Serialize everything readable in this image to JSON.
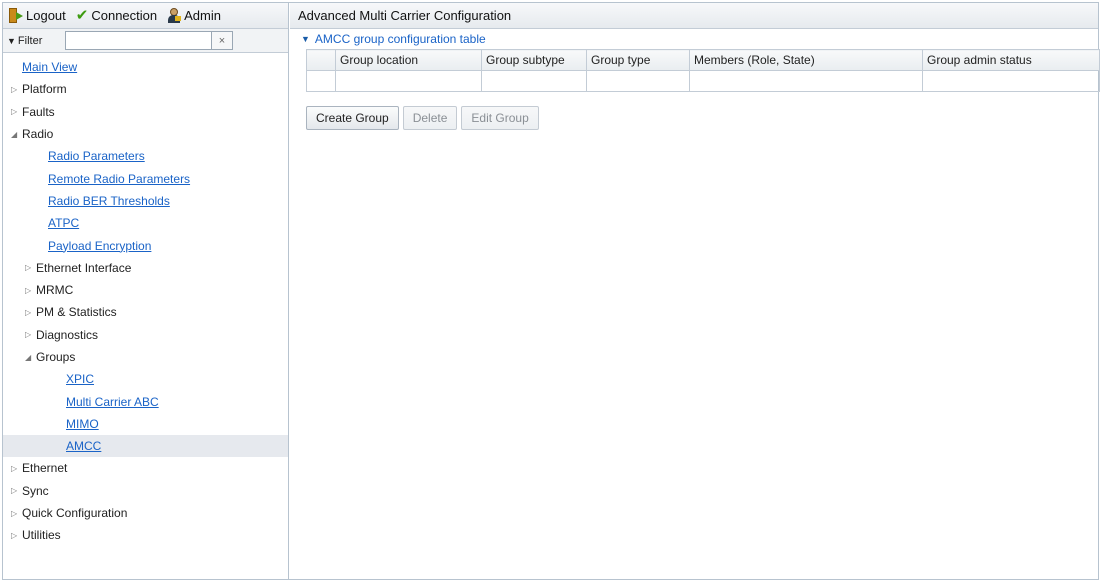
{
  "topbar": {
    "logout_label": "Logout",
    "connection_label": "Connection",
    "admin_label": "Admin"
  },
  "filter": {
    "label": "Filter",
    "value": "",
    "clear_symbol": "×"
  },
  "tree": {
    "main_view": "Main View",
    "platform": "Platform",
    "faults": "Faults",
    "radio": "Radio",
    "radio_parameters": "Radio Parameters",
    "remote_radio_parameters": "Remote Radio Parameters",
    "radio_ber_thresholds": "Radio BER Thresholds",
    "atpc": "ATPC",
    "payload_encryption": "Payload Encryption",
    "ethernet_interface": "Ethernet Interface",
    "mrmc": "MRMC",
    "pm_statistics": "PM & Statistics",
    "diagnostics": "Diagnostics",
    "groups": "Groups",
    "xpic": "XPIC",
    "multi_carrier_abc": "Multi Carrier ABC",
    "mimo": "MIMO",
    "amcc": "AMCC",
    "ethernet": "Ethernet",
    "sync": "Sync",
    "quick_configuration": "Quick Configuration",
    "utilities": "Utilities"
  },
  "main": {
    "title": "Advanced Multi Carrier Configuration",
    "section_title": "AMCC group configuration table",
    "columns": [
      "",
      "Group location",
      "Group subtype",
      "Group type",
      "Members (Role, State)",
      "Group admin status"
    ],
    "buttons": {
      "create": "Create Group",
      "delete": "Delete",
      "edit": "Edit Group"
    }
  },
  "colors": {
    "link": "#1a63c7",
    "border": "#c3ccd6",
    "selected_row": "#e6e9ee"
  }
}
